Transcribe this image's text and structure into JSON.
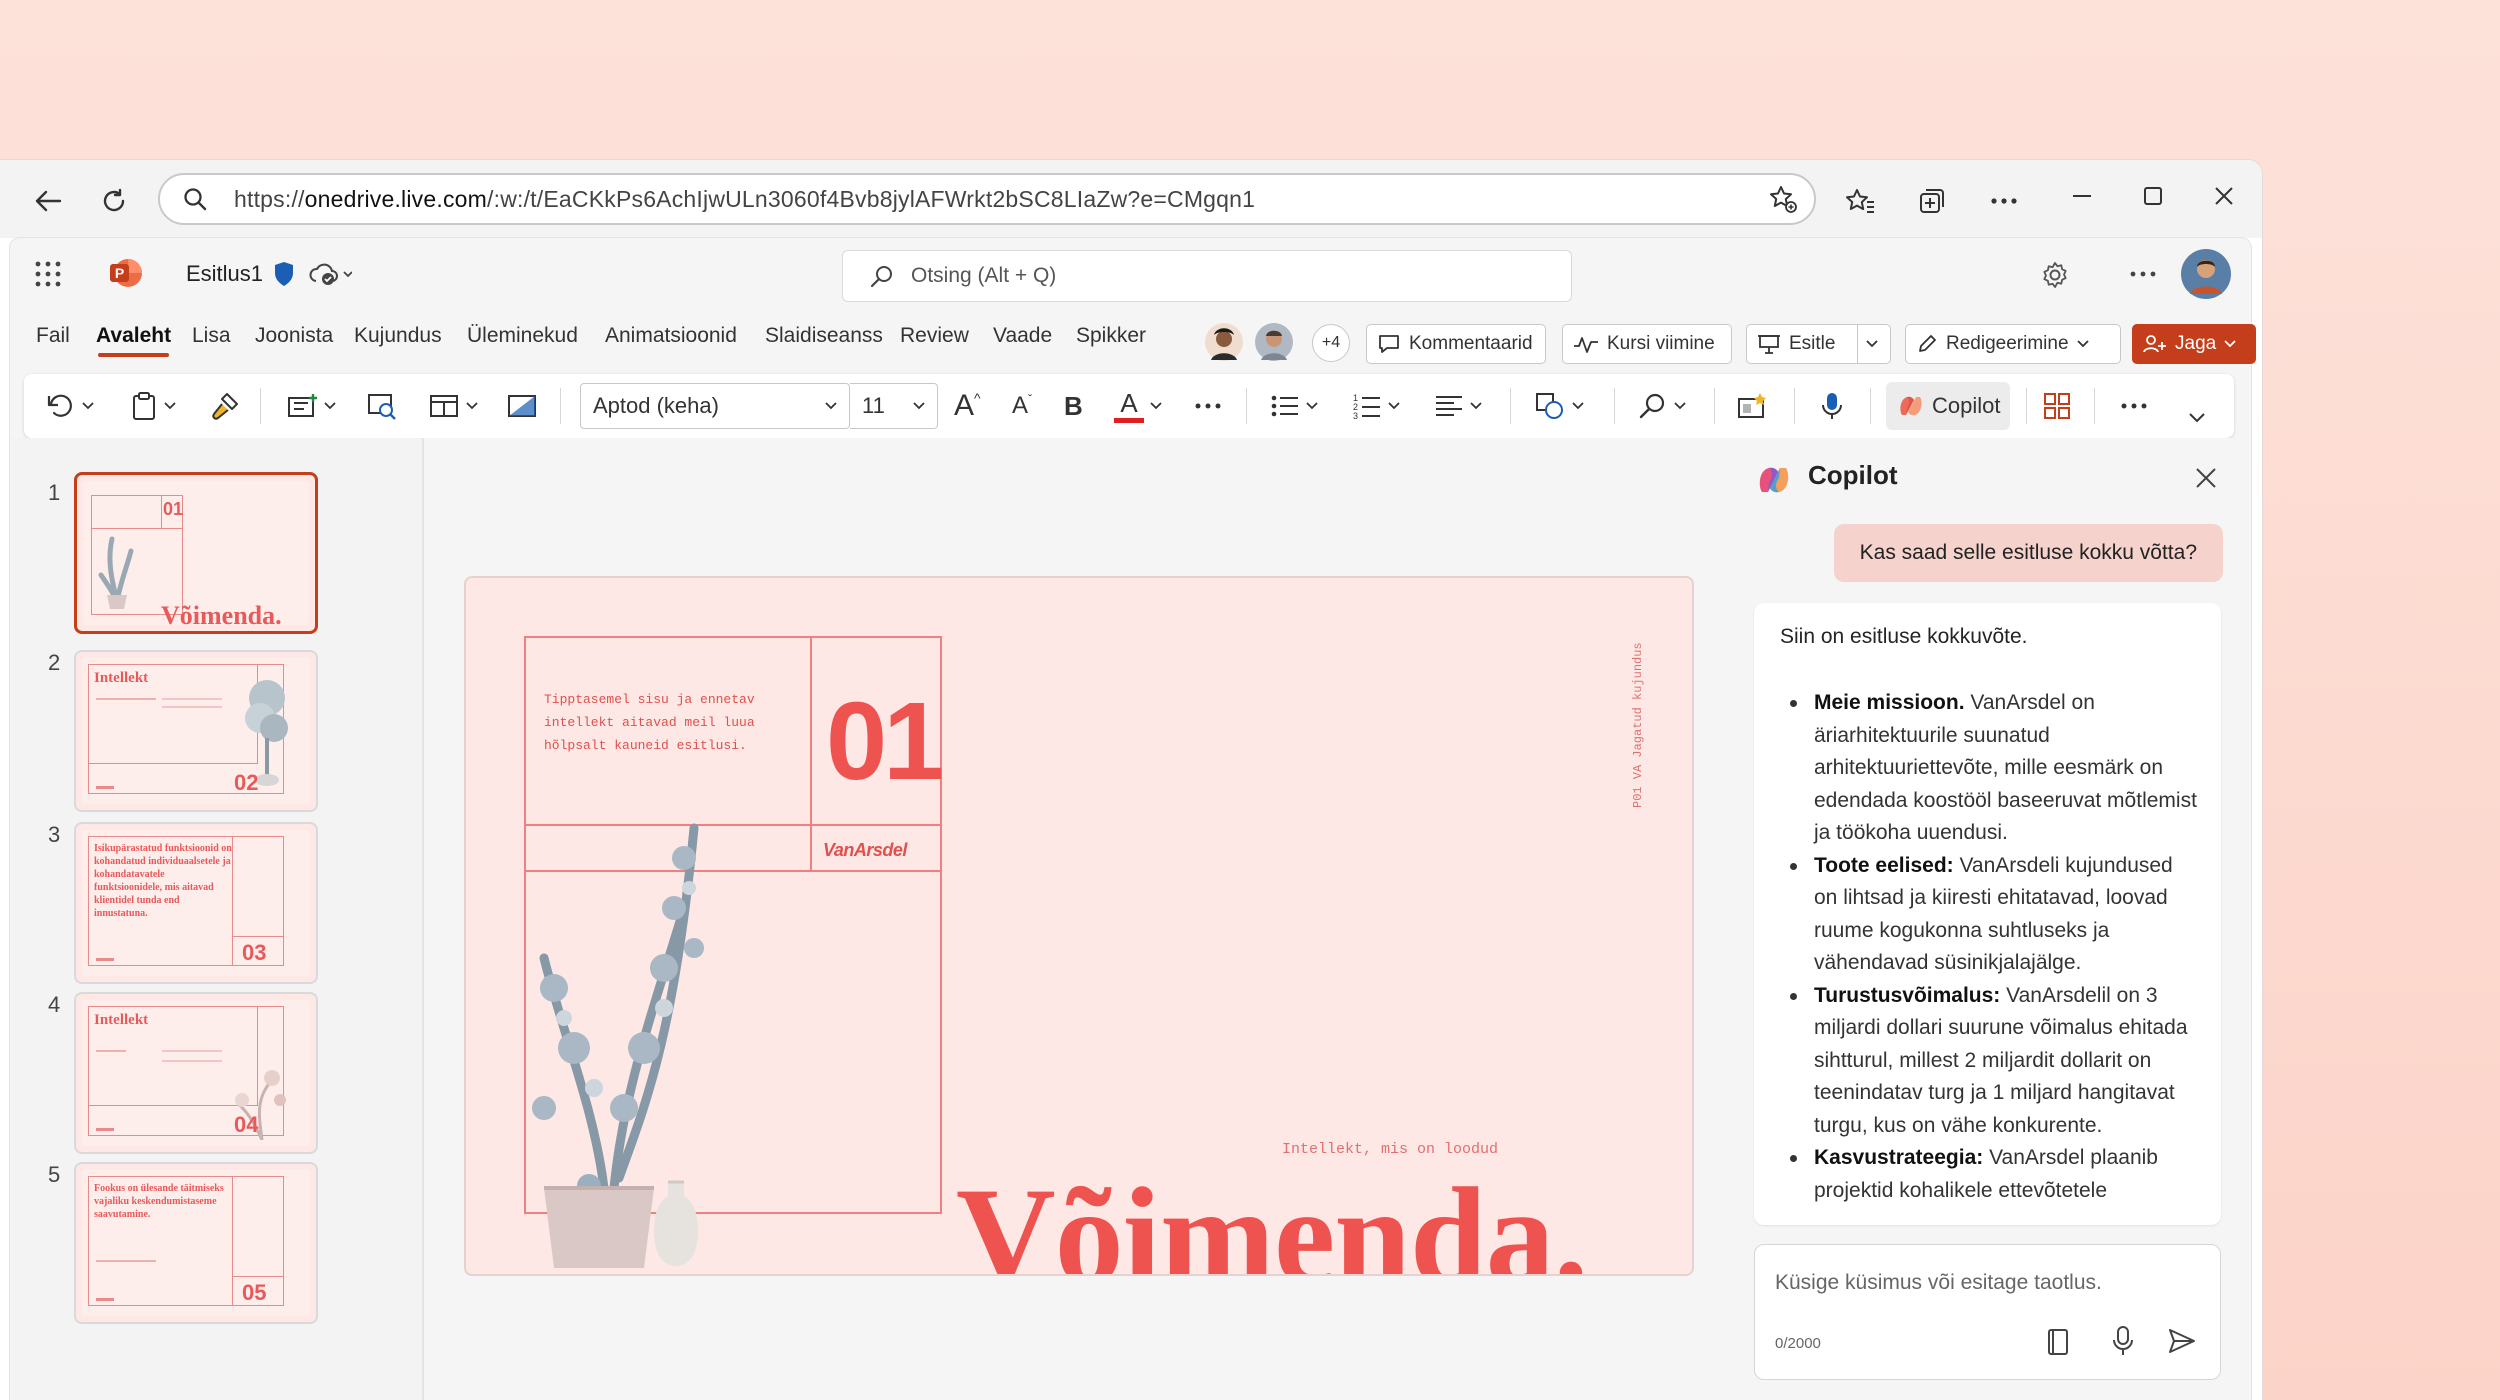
{
  "browser": {
    "url_prefix": "https://",
    "url_domain": "onedrive.live.com",
    "url_rest": "/:w:/t/EaCKkPs6AchIjwULn3060f4Bvb8jylAFWrkt2bSC8LIaZw?e=CMgqn1"
  },
  "app": {
    "file_name": "Esitlus1",
    "search_placeholder": "Otsing (Alt + Q)",
    "menu": [
      "Fail",
      "Avaleht",
      "Lisa",
      "Joonista",
      "Kujundus",
      "Üleminekud",
      "Animatsioonid",
      "Slaidiseanss",
      "Review",
      "Vaade",
      "Spikker"
    ],
    "active_menu": "Avaleht",
    "presence_extra": "+4",
    "comments_label": "Kommentaarid",
    "catchup_label": "Kursi viimine",
    "present_label": "Esitle",
    "editing_label": "Redigeerimine",
    "share_label": "Jaga",
    "brand_color": "#c43e1c"
  },
  "ribbon": {
    "font_name": "Aptod (keha)",
    "font_size": "11",
    "bold_glyph": "B",
    "font_color_glyph": "A",
    "grow_glyph": "A",
    "shrink_glyph": "A",
    "copilot_label": "Copilot"
  },
  "thumbnails": [
    {
      "num": "1",
      "title": "Võimenda.",
      "badge": "01"
    },
    {
      "num": "2",
      "title": "Intellekt",
      "badge": "02"
    },
    {
      "num": "3",
      "title": "Isikupärastatud funktsioonid on kohandatud individuaalsetele ja kohandatavatele funktsioonidele, mis aitavad klientidel tunda end innustatuna.",
      "badge": "03"
    },
    {
      "num": "4",
      "title": "Intellekt",
      "badge": "04"
    },
    {
      "num": "5",
      "title": "Fookus on ülesande täitmiseks vajaliku keskendumistaseme saavutamine.",
      "badge": "05"
    }
  ],
  "slide": {
    "number": "01",
    "intro": "Tipptasemel sisu ja ennetav intellekt aitavad meil luua hõlpsalt kauneid esitlusi.",
    "logo": "VanArsdel",
    "side_text": "P01 VA Jagatud kujundus",
    "tagline": "Intellekt, mis on loodud",
    "title": "Võimenda."
  },
  "copilot": {
    "title": "Copilot",
    "user_prompt": "Kas saad selle esitluse kokku võtta?",
    "response_intro": "Siin on esitluse kokkuvõte.",
    "items": [
      {
        "bold": "Meie missioon.",
        "text": " VanArsdel on äriarhitektuurile suunatud arhitektuuriettevõte, mille eesmärk on edendada koostööl baseeruvat mõtlemist ja töökoha uuendusi."
      },
      {
        "bold": "Toote eelised:",
        "text": " VanArsdeli kujundused on lihtsad ja kiiresti ehitatavad, loovad ruume kogukonna suhtluseks ja vähendavad süsinikjalajälge."
      },
      {
        "bold": "Turustusvõimalus:",
        "text": " VanArsdelil on 3 miljardi dollari suurune võimalus ehitada sihtturul, millest 2 miljardit dollarit on teenindatav turg ja 1 miljard hangitavat turgu, kus on vähe konkurente."
      },
      {
        "bold": "Kasvustrateegia:",
        "text": " VanArsdel plaanib projektid kohalikele ettevõtetele"
      }
    ],
    "input_placeholder": "Küsige küsimus või esitage taotlus.",
    "char_count": "0/2000"
  }
}
